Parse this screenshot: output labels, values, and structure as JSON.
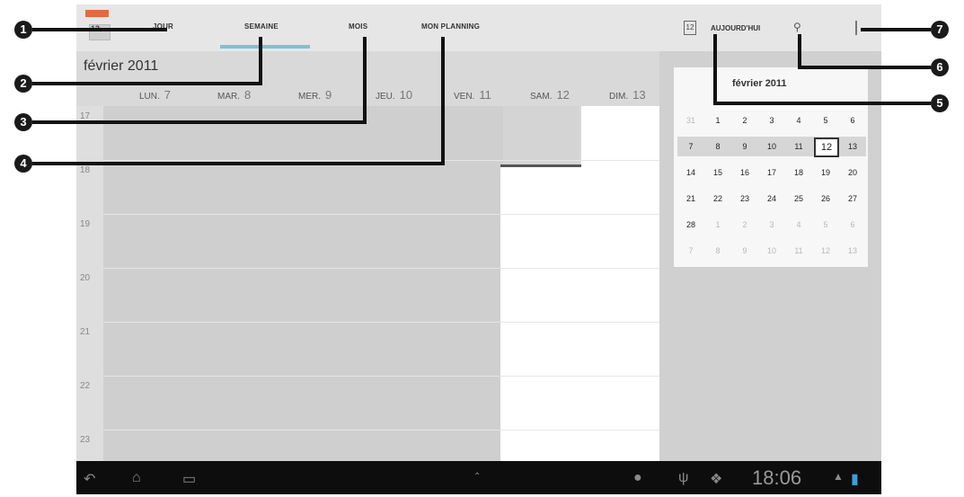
{
  "topbar": {
    "app_icon_text": "13",
    "tabs": [
      {
        "label": "JOUR"
      },
      {
        "label": "SEMAINE"
      },
      {
        "label": "MOIS"
      },
      {
        "label": "MON PLANNING"
      }
    ],
    "today_icon": "12",
    "today_label": "AUJOURD'HUI",
    "icons": {
      "today": "calendar-today-icon",
      "search": "search-icon",
      "menu": "overflow-menu-icon"
    }
  },
  "week": {
    "month_label": "février 2011",
    "days": [
      {
        "name": "LUN.",
        "num": "7"
      },
      {
        "name": "MAR.",
        "num": "8"
      },
      {
        "name": "MER.",
        "num": "9"
      },
      {
        "name": "JEU.",
        "num": "10"
      },
      {
        "name": "VEN.",
        "num": "11"
      },
      {
        "name": "SAM.",
        "num": "12"
      },
      {
        "name": "DIM.",
        "num": "13"
      }
    ],
    "hours": [
      "17",
      "18",
      "19",
      "20",
      "21",
      "22",
      "23"
    ]
  },
  "mini_calendar": {
    "title": "février 2011",
    "weeks": [
      [
        "31",
        "1",
        "2",
        "3",
        "4",
        "5",
        "6"
      ],
      [
        "7",
        "8",
        "9",
        "10",
        "11",
        "12",
        "13"
      ],
      [
        "14",
        "15",
        "16",
        "17",
        "18",
        "19",
        "20"
      ],
      [
        "21",
        "22",
        "23",
        "24",
        "25",
        "26",
        "27"
      ],
      [
        "28",
        "1",
        "2",
        "3",
        "4",
        "5",
        "6"
      ],
      [
        "7",
        "8",
        "9",
        "10",
        "11",
        "12",
        "13"
      ]
    ],
    "today": "12"
  },
  "systembar": {
    "time": "18:06",
    "icons": [
      "back-icon",
      "home-icon",
      "recent-apps-icon",
      "up-arrow-icon",
      "notification-icon",
      "usb-icon",
      "download-icon",
      "signal-icon",
      "battery-icon"
    ]
  },
  "callouts": [
    "1",
    "2",
    "3",
    "4",
    "5",
    "6",
    "7"
  ]
}
